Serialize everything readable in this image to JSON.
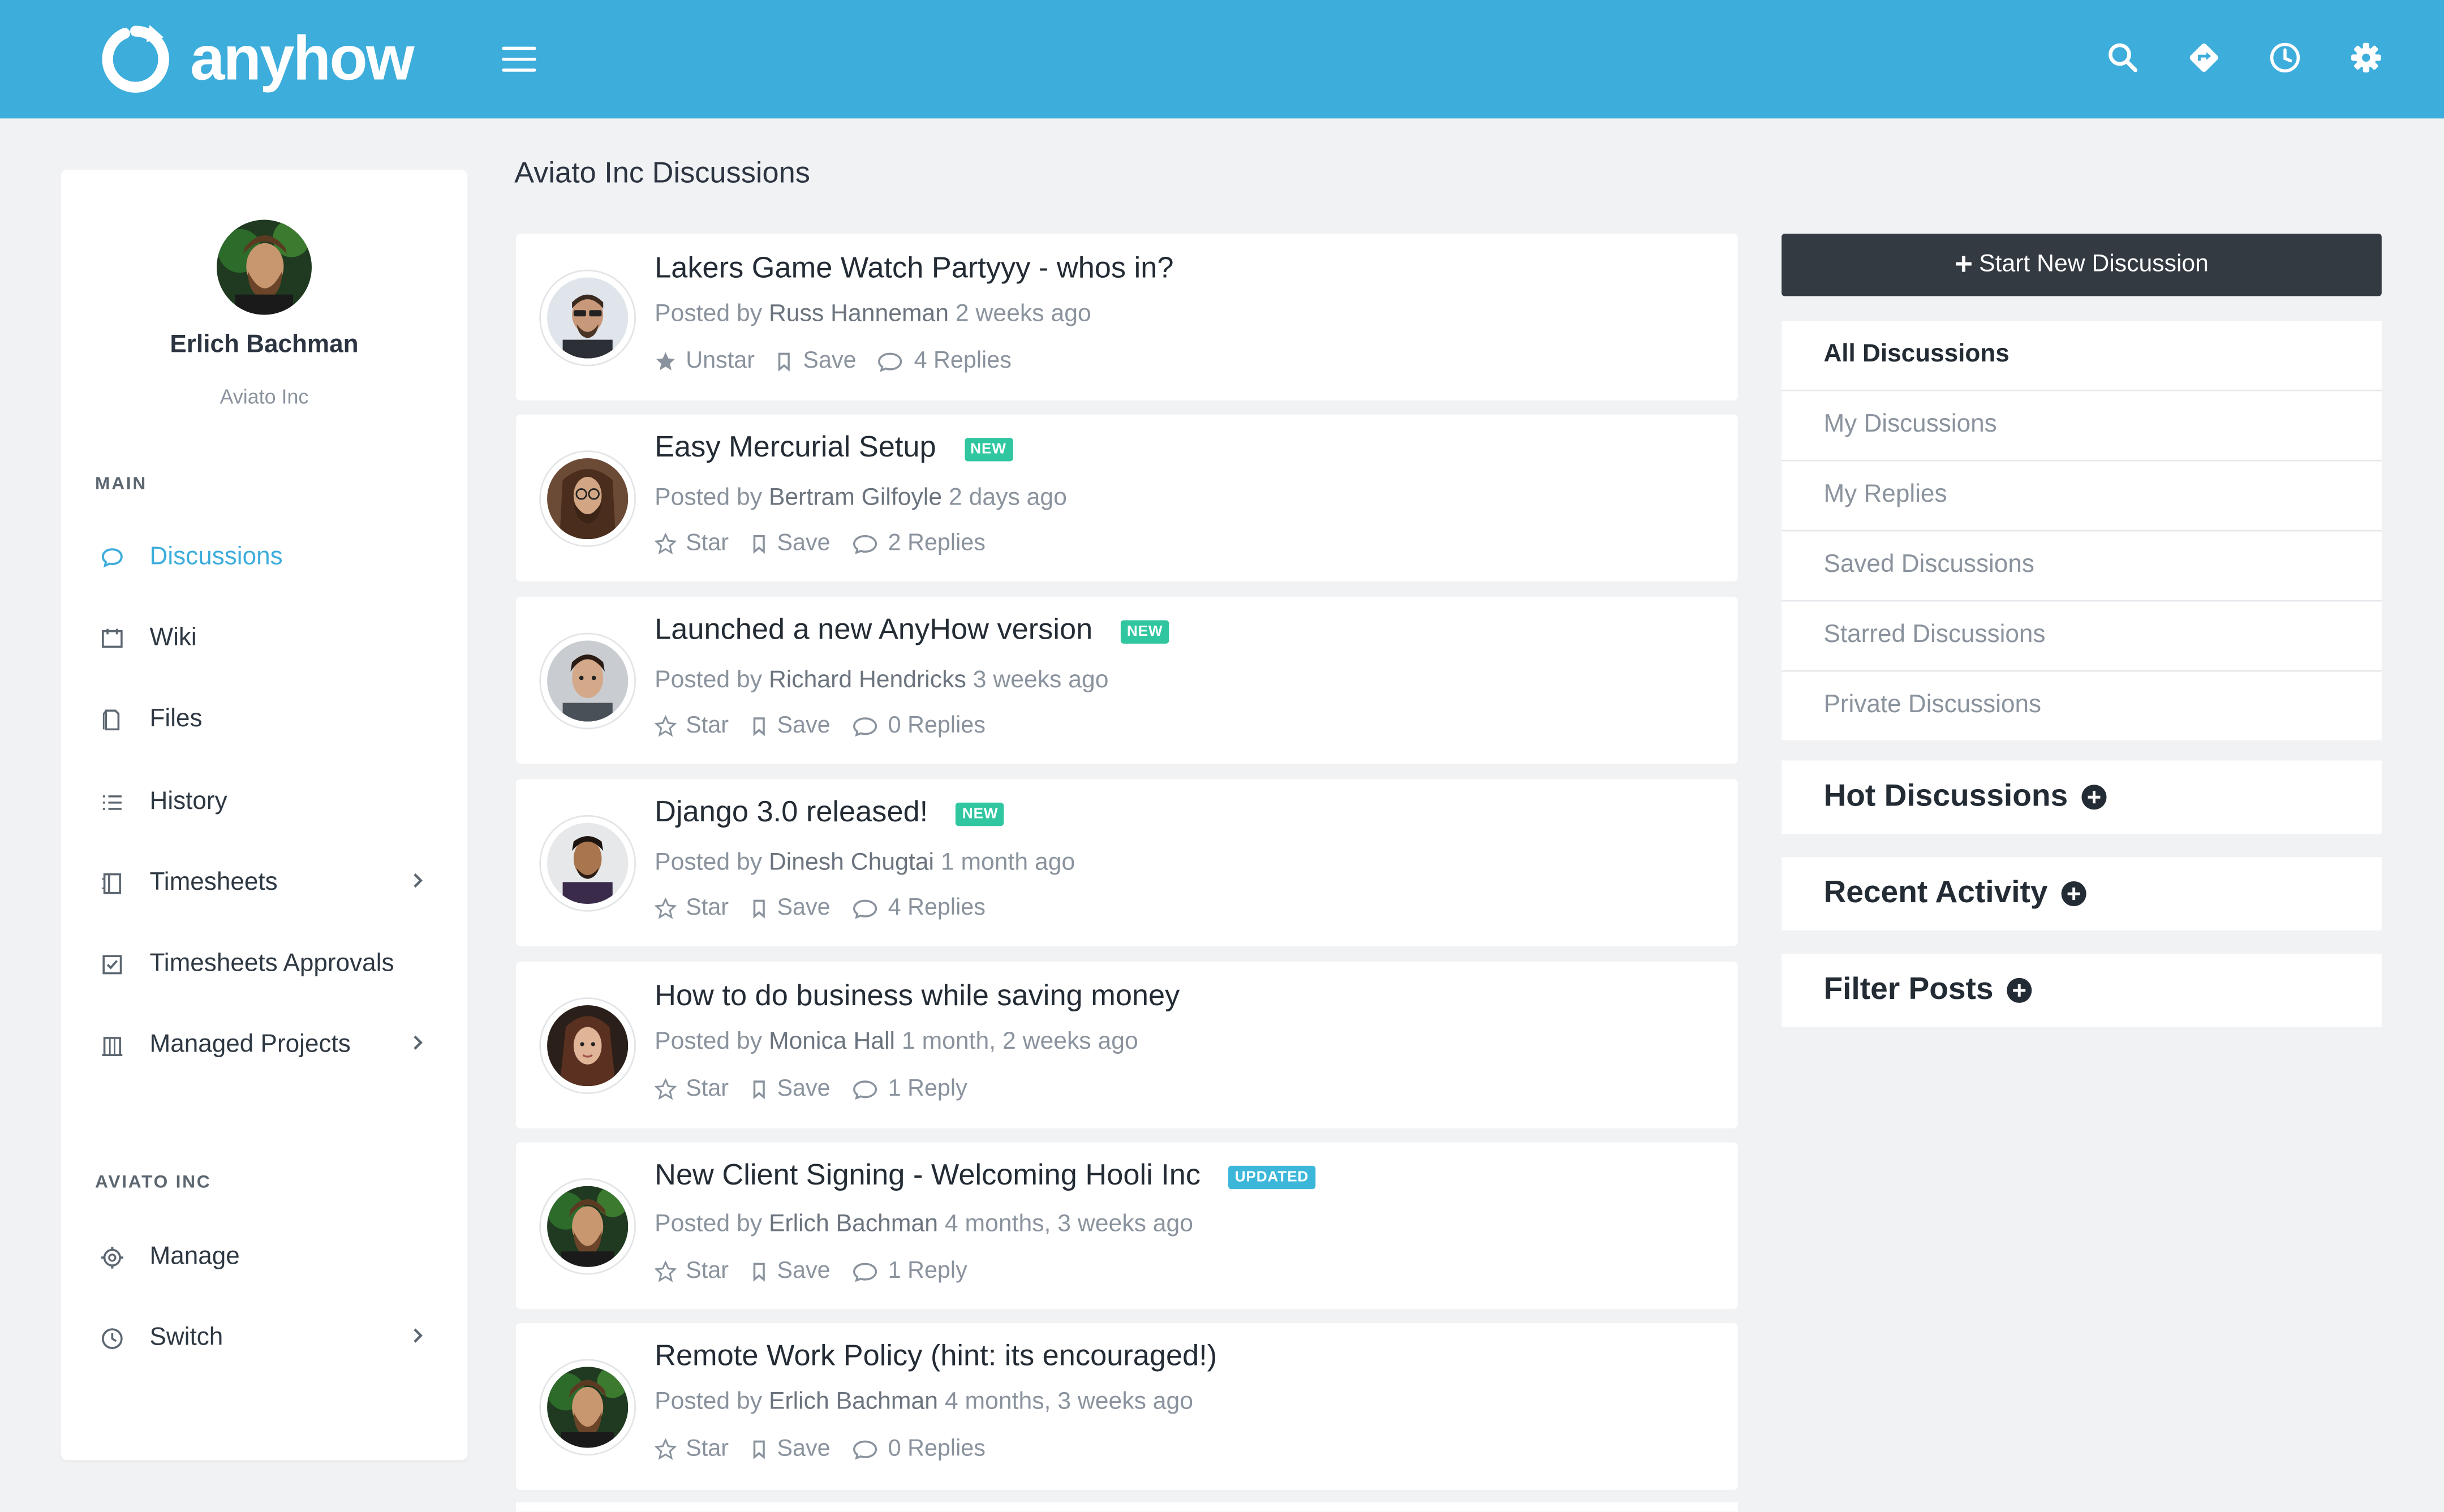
{
  "app": {
    "name": "anyhow"
  },
  "colors": {
    "brand": "#3daddb",
    "new_badge": "#30c6a0",
    "updated_badge": "#3cb7d9",
    "dark_button": "#343a42"
  },
  "topbar": {
    "icons": [
      "search-icon",
      "directions-icon",
      "clock-icon",
      "gear-icon"
    ]
  },
  "user": {
    "name": "Erlich Bachman",
    "org": "Aviato Inc"
  },
  "sidebar": {
    "main_label": "MAIN",
    "items": [
      {
        "label": "Discussions",
        "icon": "chat-icon",
        "active": true
      },
      {
        "label": "Wiki",
        "icon": "board-icon"
      },
      {
        "label": "Files",
        "icon": "file-icon"
      },
      {
        "label": "History",
        "icon": "list-icon"
      },
      {
        "label": "Timesheets",
        "icon": "notebook-icon",
        "has_submenu": true
      },
      {
        "label": "Timesheets Approvals",
        "icon": "checkbox-icon"
      },
      {
        "label": "Managed Projects",
        "icon": "building-icon",
        "has_submenu": true
      }
    ],
    "org_label": "AVIATO INC",
    "org_items": [
      {
        "label": "Manage",
        "icon": "cog-icon"
      },
      {
        "label": "Switch",
        "icon": "switch-icon",
        "has_submenu": true
      }
    ]
  },
  "page": {
    "title": "Aviato Inc Discussions"
  },
  "discussions": [
    {
      "title": "Lakers Game Watch Partyyy - whos in?",
      "badge": "",
      "posted_by_prefix": "Posted by",
      "author": "Russ Hanneman",
      "time": "2 weeks ago",
      "star_label": "Unstar",
      "starred": true,
      "save_label": "Save",
      "replies": "4 Replies"
    },
    {
      "title": "Easy Mercurial Setup",
      "badge": "NEW",
      "posted_by_prefix": "Posted by",
      "author": "Bertram Gilfoyle",
      "time": "2 days ago",
      "star_label": "Star",
      "save_label": "Save",
      "replies": "2 Replies"
    },
    {
      "title": "Launched a new AnyHow version",
      "badge": "NEW",
      "posted_by_prefix": "Posted by",
      "author": "Richard Hendricks",
      "time": "3 weeks ago",
      "star_label": "Star",
      "save_label": "Save",
      "replies": "0 Replies"
    },
    {
      "title": "Django 3.0 released!",
      "badge": "NEW",
      "posted_by_prefix": "Posted by",
      "author": "Dinesh Chugtai",
      "time": "1 month ago",
      "star_label": "Star",
      "save_label": "Save",
      "replies": "4 Replies"
    },
    {
      "title": "How to do business while saving money",
      "badge": "",
      "posted_by_prefix": "Posted by",
      "author": "Monica Hall",
      "time": "1 month, 2 weeks ago",
      "star_label": "Star",
      "save_label": "Save",
      "replies": "1 Reply"
    },
    {
      "title": "New Client Signing - Welcoming Hooli Inc",
      "badge": "UPDATED",
      "posted_by_prefix": "Posted by",
      "author": "Erlich Bachman",
      "time": "4 months, 3 weeks ago",
      "star_label": "Star",
      "save_label": "Save",
      "replies": "1 Reply"
    },
    {
      "title": "Remote Work Policy (hint: its encouraged!)",
      "badge": "",
      "posted_by_prefix": "Posted by",
      "author": "Erlich Bachman",
      "time": "4 months, 3 weeks ago",
      "star_label": "Star",
      "save_label": "Save",
      "replies": "0 Replies"
    }
  ],
  "right": {
    "new_button": "Start New Discussion",
    "filters": [
      {
        "label": "All Discussions",
        "active": true
      },
      {
        "label": "My Discussions"
      },
      {
        "label": "My Replies"
      },
      {
        "label": "Saved Discussions"
      },
      {
        "label": "Starred Discussions"
      },
      {
        "label": "Private Discussions"
      }
    ],
    "panels": [
      "Hot Discussions",
      "Recent Activity",
      "Filter Posts"
    ]
  }
}
